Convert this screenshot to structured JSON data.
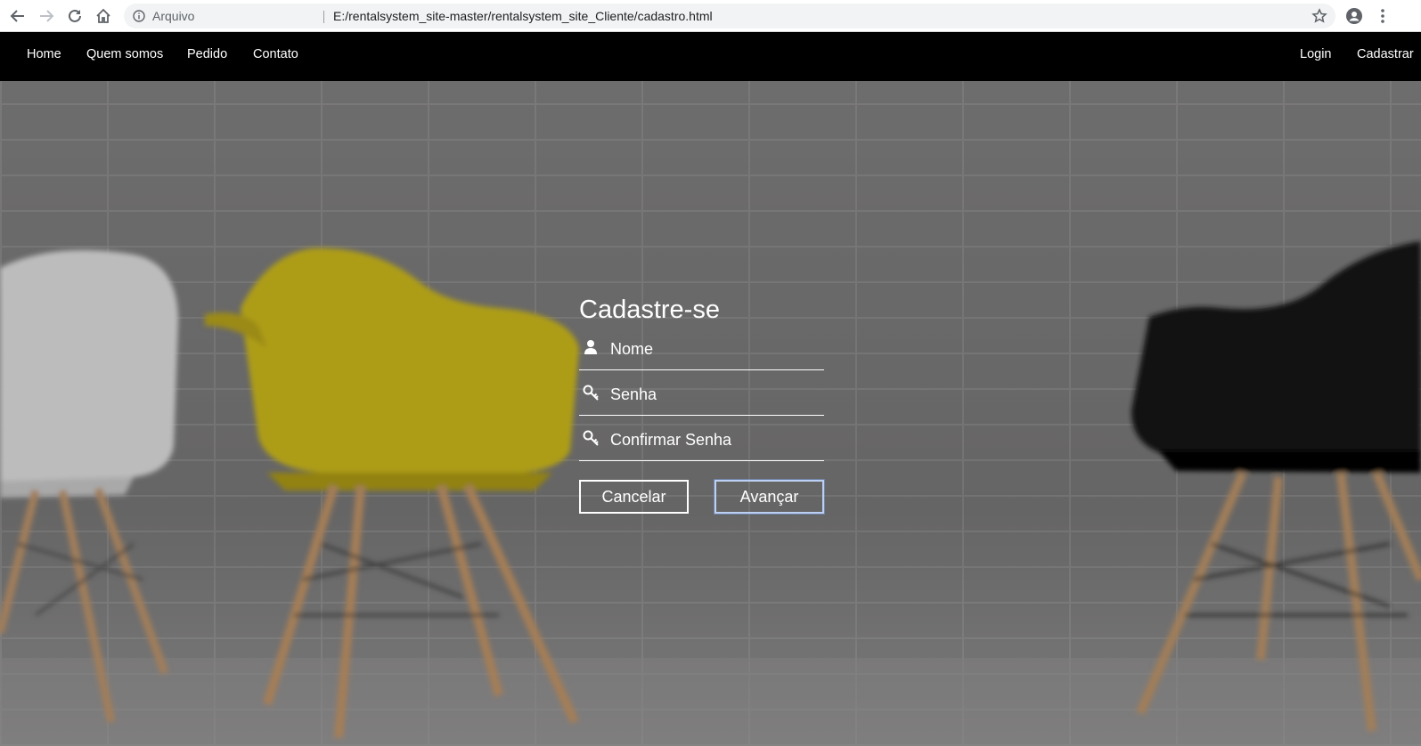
{
  "browser": {
    "security_label": "Arquivo",
    "url": "E:/rentalsystem_site-master/rentalsystem_site_Cliente/cadastro.html",
    "icons": [
      "back-arrow-icon",
      "forward-arrow-icon",
      "reload-icon",
      "home-icon",
      "info-icon",
      "star-icon",
      "account-icon",
      "menu-dots-icon"
    ]
  },
  "navbar": {
    "left_links": [
      "Home",
      "Quem somos",
      "Pedido",
      "Contato"
    ],
    "right_links": [
      "Login",
      "Cadastrar"
    ]
  },
  "form": {
    "title": "Cadastre-se",
    "fields": [
      {
        "placeholder": "Nome",
        "icon": "user-icon"
      },
      {
        "placeholder": "Senha",
        "icon": "key-icon"
      },
      {
        "placeholder": "Confirmar Senha",
        "icon": "key-icon"
      }
    ],
    "cancel_label": "Cancelar",
    "submit_label": "Avançar"
  },
  "colors": {
    "navbar": "#000000",
    "text": "#ffffff",
    "chair_yellow": "#d8c31c",
    "chair_black": "#0f0f0f",
    "chair_white": "#e9e9e9"
  }
}
